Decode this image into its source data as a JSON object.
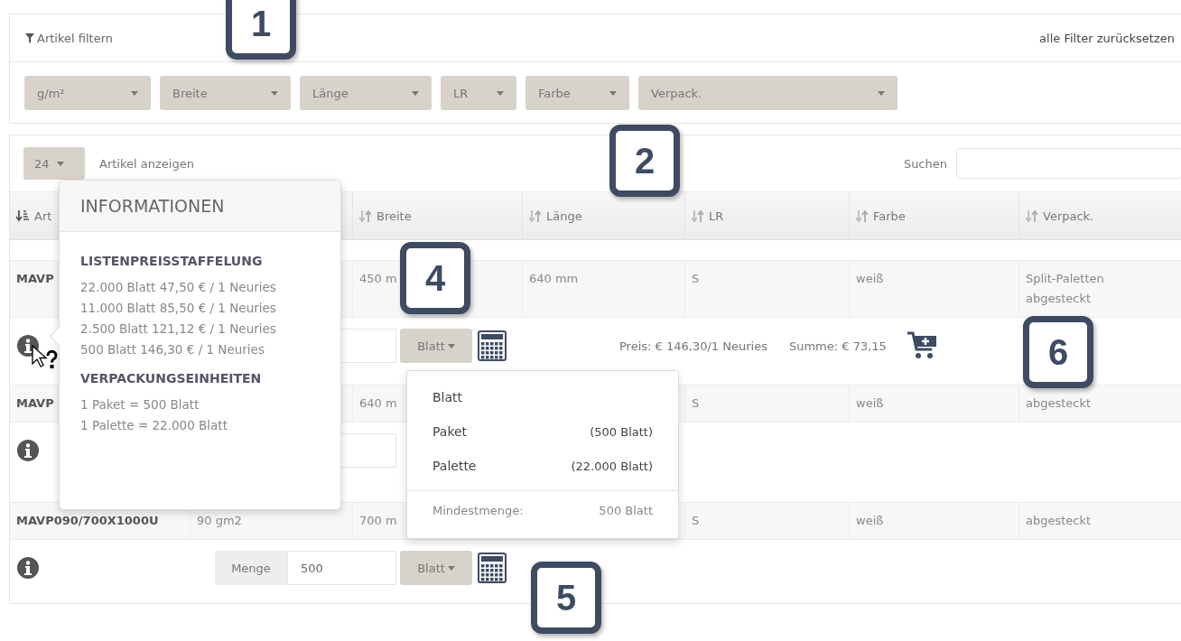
{
  "filter_panel": {
    "title": "Artikel filtern",
    "reset_link": "alle Filter zurücksetzen",
    "filters": [
      "g/m²",
      "Breite",
      "Länge",
      "LR",
      "Farbe",
      "Verpack."
    ]
  },
  "list_toolbar": {
    "page_size": "24",
    "page_size_label": "Artikel anzeigen",
    "search_label": "Suchen"
  },
  "table": {
    "columns": [
      {
        "label": "Art",
        "sorted": true
      },
      {},
      {
        "label": "Breite",
        "sorted": false
      },
      {
        "label": "Länge",
        "sorted": false
      },
      {
        "label": "LR",
        "sorted": false
      },
      {
        "label": "Farbe",
        "sorted": false
      },
      {
        "label": "Verpack.",
        "sorted": false
      }
    ],
    "rows": [
      {
        "cells": [
          "MAVP",
          null,
          "450 m",
          "640 mm",
          "S",
          "weiß",
          "Split-Paletten abgesteckt"
        ],
        "unit": "Blatt",
        "price": "Preis: € 146,30/1 Neuries",
        "sum": "Summe: € 73,15"
      },
      {
        "cells": [
          "MAVP",
          null,
          "640 m",
          null,
          "S",
          "weiß",
          "abgesteckt"
        ]
      },
      {
        "cells": [
          "MAVP090/700X1000U",
          "90 gm2",
          "700 m",
          null,
          "S",
          "weiß",
          "abgesteckt"
        ],
        "quantity_label": "Menge",
        "quantity": "500",
        "unit": "Blatt"
      }
    ]
  },
  "info_popover": {
    "title": "INFORMATIONEN",
    "sections": [
      {
        "heading": "LISTENPREISSTAFFELUNG",
        "lines": [
          "22.000 Blatt 47,50 € / 1 Neuries",
          "11.000 Blatt 85,50 € / 1 Neuries",
          "2.500 Blatt 121,12 € / 1 Neuries",
          "500 Blatt 146,30 € / 1 Neuries"
        ]
      },
      {
        "heading": "VERPACKUNGSEINHEITEN",
        "lines": [
          "1 Paket = 500 Blatt",
          "1 Palette = 22.000 Blatt"
        ]
      }
    ]
  },
  "unit_menu": {
    "items": [
      {
        "label": "Blatt"
      },
      {
        "label": "Paket",
        "note": "(500 Blatt)"
      },
      {
        "label": "Palette",
        "note": "(22.000 Blatt)"
      }
    ],
    "minimum_label": "Mindestmenge:",
    "minimum_value": "500 Blatt"
  },
  "callouts": [
    "1",
    "2",
    "4",
    "5",
    "6"
  ]
}
